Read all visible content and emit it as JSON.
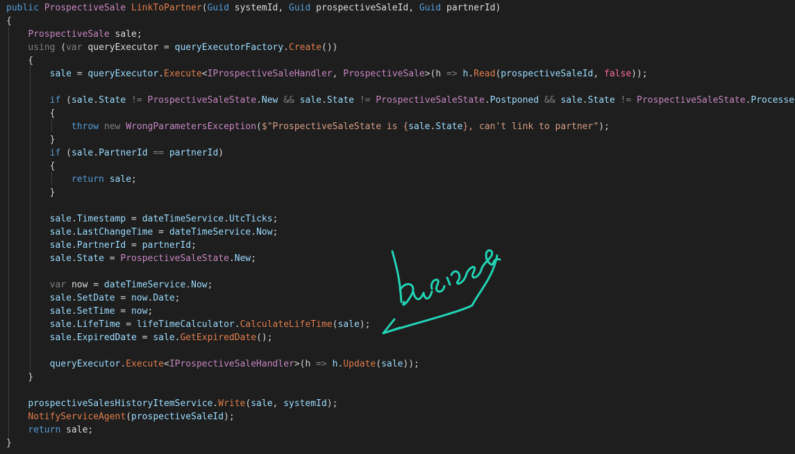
{
  "editor": {
    "theme": {
      "background": "#1e1e1e",
      "keyword": "#569cd6",
      "type": "#c586c0",
      "method": "#e07d4c",
      "variable": "#9cdcfe",
      "string": "#d69d85",
      "false_literal": "#ff6b9a",
      "signature_ink": "#22d3b4"
    },
    "lines": [
      [
        [
          "kw",
          "public "
        ],
        [
          "type",
          "ProspectiveSale "
        ],
        [
          "fn",
          "LinkToPartner"
        ],
        [
          "plain",
          "("
        ],
        [
          "kw",
          "Guid "
        ],
        [
          "local",
          "systemId"
        ],
        [
          "plain",
          ", "
        ],
        [
          "kw",
          "Guid "
        ],
        [
          "local",
          "prospectiveSaleId"
        ],
        [
          "plain",
          ", "
        ],
        [
          "kw",
          "Guid "
        ],
        [
          "local",
          "partnerId"
        ],
        [
          "plain",
          ")"
        ]
      ],
      [
        [
          "plain",
          "{"
        ]
      ],
      [
        [
          "plain",
          "    "
        ],
        [
          "type",
          "ProspectiveSale "
        ],
        [
          "local",
          "sale"
        ],
        [
          "plain",
          ";"
        ]
      ],
      [
        [
          "plain",
          "    "
        ],
        [
          "dim",
          "using "
        ],
        [
          "plain",
          "("
        ],
        [
          "dim",
          "var "
        ],
        [
          "local",
          "queryExecutor"
        ],
        [
          "plain",
          " = "
        ],
        [
          "var",
          "queryExecutorFactory"
        ],
        [
          "plain",
          "."
        ],
        [
          "fn",
          "Create"
        ],
        [
          "plain",
          "())"
        ]
      ],
      [
        [
          "plain",
          "    {"
        ]
      ],
      [
        [
          "plain",
          "        "
        ],
        [
          "var",
          "sale"
        ],
        [
          "plain",
          " = "
        ],
        [
          "var",
          "queryExecutor"
        ],
        [
          "plain",
          "."
        ],
        [
          "fn",
          "Execute"
        ],
        [
          "plain",
          "<"
        ],
        [
          "type",
          "IProspectiveSaleHandler"
        ],
        [
          "plain",
          ", "
        ],
        [
          "type",
          "ProspectiveSale"
        ],
        [
          "plain",
          ">(h "
        ],
        [
          "dim",
          "=>"
        ],
        [
          "plain",
          " "
        ],
        [
          "var",
          "h"
        ],
        [
          "plain",
          "."
        ],
        [
          "fn",
          "Read"
        ],
        [
          "plain",
          "("
        ],
        [
          "var",
          "prospectiveSaleId"
        ],
        [
          "plain",
          ", "
        ],
        [
          "false",
          "false"
        ],
        [
          "plain",
          "));"
        ]
      ],
      [
        [
          "plain",
          ""
        ]
      ],
      [
        [
          "plain",
          "        "
        ],
        [
          "kw",
          "if "
        ],
        [
          "plain",
          "("
        ],
        [
          "var",
          "sale"
        ],
        [
          "plain",
          "."
        ],
        [
          "var",
          "State"
        ],
        [
          "plain",
          " "
        ],
        [
          "dim",
          "!="
        ],
        [
          "plain",
          " "
        ],
        [
          "type",
          "ProspectiveSaleState"
        ],
        [
          "plain",
          "."
        ],
        [
          "var",
          "New"
        ],
        [
          "plain",
          " "
        ],
        [
          "dim",
          "&&"
        ],
        [
          "plain",
          " "
        ],
        [
          "var",
          "sale"
        ],
        [
          "plain",
          "."
        ],
        [
          "var",
          "State"
        ],
        [
          "plain",
          " "
        ],
        [
          "dim",
          "!="
        ],
        [
          "plain",
          " "
        ],
        [
          "type",
          "ProspectiveSaleState"
        ],
        [
          "plain",
          "."
        ],
        [
          "var",
          "Postponed"
        ],
        [
          "plain",
          " "
        ],
        [
          "dim",
          "&&"
        ],
        [
          "plain",
          " "
        ],
        [
          "var",
          "sale"
        ],
        [
          "plain",
          "."
        ],
        [
          "var",
          "State"
        ],
        [
          "plain",
          " "
        ],
        [
          "dim",
          "!="
        ],
        [
          "plain",
          " "
        ],
        [
          "type",
          "ProspectiveSaleState"
        ],
        [
          "plain",
          "."
        ],
        [
          "var",
          "Processed"
        ],
        [
          "plain",
          ")"
        ]
      ],
      [
        [
          "plain",
          "        {"
        ]
      ],
      [
        [
          "plain",
          "            "
        ],
        [
          "kw",
          "throw "
        ],
        [
          "dim",
          "new "
        ],
        [
          "type",
          "WrongParametersException"
        ],
        [
          "plain",
          "("
        ],
        [
          "str",
          "$\"ProspectiveSaleState is {"
        ],
        [
          "var",
          "sale"
        ],
        [
          "plain",
          "."
        ],
        [
          "var",
          "State"
        ],
        [
          "str",
          "}, can't link to partner\""
        ],
        [
          "plain",
          ");"
        ]
      ],
      [
        [
          "plain",
          "        }"
        ]
      ],
      [
        [
          "plain",
          "        "
        ],
        [
          "kw",
          "if "
        ],
        [
          "plain",
          "("
        ],
        [
          "var",
          "sale"
        ],
        [
          "plain",
          "."
        ],
        [
          "var",
          "PartnerId"
        ],
        [
          "plain",
          " "
        ],
        [
          "dim",
          "=="
        ],
        [
          "plain",
          " "
        ],
        [
          "var",
          "partnerId"
        ],
        [
          "plain",
          ")"
        ]
      ],
      [
        [
          "plain",
          "        {"
        ]
      ],
      [
        [
          "plain",
          "            "
        ],
        [
          "kw",
          "return "
        ],
        [
          "var",
          "sale"
        ],
        [
          "plain",
          ";"
        ]
      ],
      [
        [
          "plain",
          "        }"
        ]
      ],
      [
        [
          "plain",
          ""
        ]
      ],
      [
        [
          "plain",
          "        "
        ],
        [
          "var",
          "sale"
        ],
        [
          "plain",
          "."
        ],
        [
          "var",
          "Timestamp"
        ],
        [
          "plain",
          " = "
        ],
        [
          "var",
          "dateTimeService"
        ],
        [
          "plain",
          "."
        ],
        [
          "var",
          "UtcTicks"
        ],
        [
          "plain",
          ";"
        ]
      ],
      [
        [
          "plain",
          "        "
        ],
        [
          "var",
          "sale"
        ],
        [
          "plain",
          "."
        ],
        [
          "var",
          "LastChangeTime"
        ],
        [
          "plain",
          " = "
        ],
        [
          "var",
          "dateTimeService"
        ],
        [
          "plain",
          "."
        ],
        [
          "var",
          "Now"
        ],
        [
          "plain",
          ";"
        ]
      ],
      [
        [
          "plain",
          "        "
        ],
        [
          "var",
          "sale"
        ],
        [
          "plain",
          "."
        ],
        [
          "var",
          "PartnerId"
        ],
        [
          "plain",
          " = "
        ],
        [
          "var",
          "partnerId"
        ],
        [
          "plain",
          ";"
        ]
      ],
      [
        [
          "plain",
          "        "
        ],
        [
          "var",
          "sale"
        ],
        [
          "plain",
          "."
        ],
        [
          "var",
          "State"
        ],
        [
          "plain",
          " = "
        ],
        [
          "type",
          "ProspectiveSaleState"
        ],
        [
          "plain",
          "."
        ],
        [
          "var",
          "New"
        ],
        [
          "plain",
          ";"
        ]
      ],
      [
        [
          "plain",
          ""
        ]
      ],
      [
        [
          "plain",
          "        "
        ],
        [
          "dim",
          "var "
        ],
        [
          "local",
          "now"
        ],
        [
          "plain",
          " = "
        ],
        [
          "var",
          "dateTimeService"
        ],
        [
          "plain",
          "."
        ],
        [
          "var",
          "Now"
        ],
        [
          "plain",
          ";"
        ]
      ],
      [
        [
          "plain",
          "        "
        ],
        [
          "var",
          "sale"
        ],
        [
          "plain",
          "."
        ],
        [
          "var",
          "SetDate"
        ],
        [
          "plain",
          " = "
        ],
        [
          "var",
          "now"
        ],
        [
          "plain",
          "."
        ],
        [
          "var",
          "Date"
        ],
        [
          "plain",
          ";"
        ]
      ],
      [
        [
          "plain",
          "        "
        ],
        [
          "var",
          "sale"
        ],
        [
          "plain",
          "."
        ],
        [
          "var",
          "SetTime"
        ],
        [
          "plain",
          " = "
        ],
        [
          "var",
          "now"
        ],
        [
          "plain",
          ";"
        ]
      ],
      [
        [
          "plain",
          "        "
        ],
        [
          "var",
          "sale"
        ],
        [
          "plain",
          "."
        ],
        [
          "var",
          "LifeTime"
        ],
        [
          "plain",
          " = "
        ],
        [
          "var",
          "lifeTimeCalculator"
        ],
        [
          "plain",
          "."
        ],
        [
          "fn",
          "CalculateLifeTime"
        ],
        [
          "plain",
          "("
        ],
        [
          "var",
          "sale"
        ],
        [
          "plain",
          ");"
        ]
      ],
      [
        [
          "plain",
          "        "
        ],
        [
          "var",
          "sale"
        ],
        [
          "plain",
          "."
        ],
        [
          "var",
          "ExpiredDate"
        ],
        [
          "plain",
          " = "
        ],
        [
          "var",
          "sale"
        ],
        [
          "plain",
          "."
        ],
        [
          "fn",
          "GetExpiredDate"
        ],
        [
          "plain",
          "();"
        ]
      ],
      [
        [
          "plain",
          ""
        ]
      ],
      [
        [
          "plain",
          "        "
        ],
        [
          "var",
          "queryExecutor"
        ],
        [
          "plain",
          "."
        ],
        [
          "fn",
          "Execute"
        ],
        [
          "plain",
          "<"
        ],
        [
          "type",
          "IProspectiveSaleHandler"
        ],
        [
          "plain",
          ">(h "
        ],
        [
          "dim",
          "=>"
        ],
        [
          "plain",
          " "
        ],
        [
          "var",
          "h"
        ],
        [
          "plain",
          "."
        ],
        [
          "fn",
          "Update"
        ],
        [
          "plain",
          "("
        ],
        [
          "var",
          "sale"
        ],
        [
          "plain",
          "));"
        ]
      ],
      [
        [
          "plain",
          "    }"
        ]
      ],
      [
        [
          "plain",
          ""
        ]
      ],
      [
        [
          "plain",
          "    "
        ],
        [
          "var",
          "prospectiveSalesHistoryItemService"
        ],
        [
          "plain",
          "."
        ],
        [
          "fn",
          "Write"
        ],
        [
          "plain",
          "("
        ],
        [
          "var",
          "sale"
        ],
        [
          "plain",
          ", "
        ],
        [
          "var",
          "systemId"
        ],
        [
          "plain",
          ");"
        ]
      ],
      [
        [
          "plain",
          "    "
        ],
        [
          "fn",
          "NotifyServiceAgent"
        ],
        [
          "plain",
          "("
        ],
        [
          "var",
          "prospectiveSaleId"
        ],
        [
          "plain",
          ");"
        ]
      ],
      [
        [
          "plain",
          "    "
        ],
        [
          "kw",
          "return "
        ],
        [
          "local",
          "sale"
        ],
        [
          "plain",
          ";"
        ]
      ],
      [
        [
          "plain",
          "}"
        ]
      ]
    ],
    "signature_text": "Business"
  }
}
